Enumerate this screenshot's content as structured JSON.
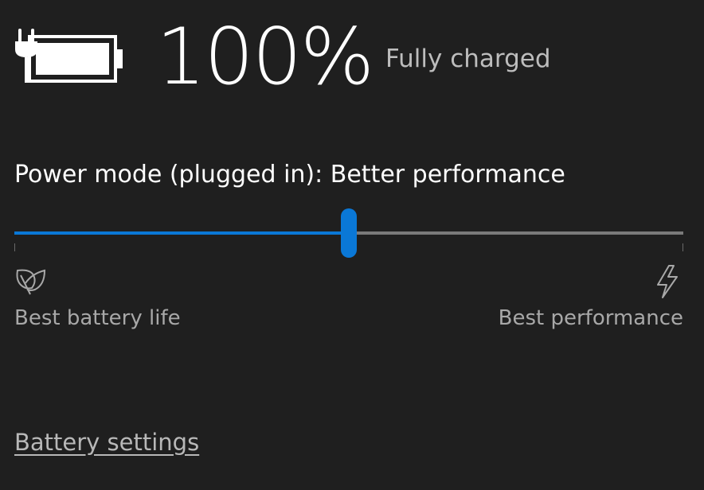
{
  "battery": {
    "icon": "battery-plugged-icon",
    "percent_label": "100%",
    "level": 1.0,
    "status": "Fully charged"
  },
  "power_mode": {
    "label": "Power mode (plugged in): Better performance",
    "slider_value": 0.5,
    "accent_color": "#0a78d7",
    "track_color": "#7a7a7a",
    "min_label": "Best battery life",
    "min_icon": "leaf-icon",
    "max_label": "Best performance",
    "max_icon": "lightning-bolt-icon"
  },
  "links": {
    "battery_settings": "Battery settings"
  }
}
